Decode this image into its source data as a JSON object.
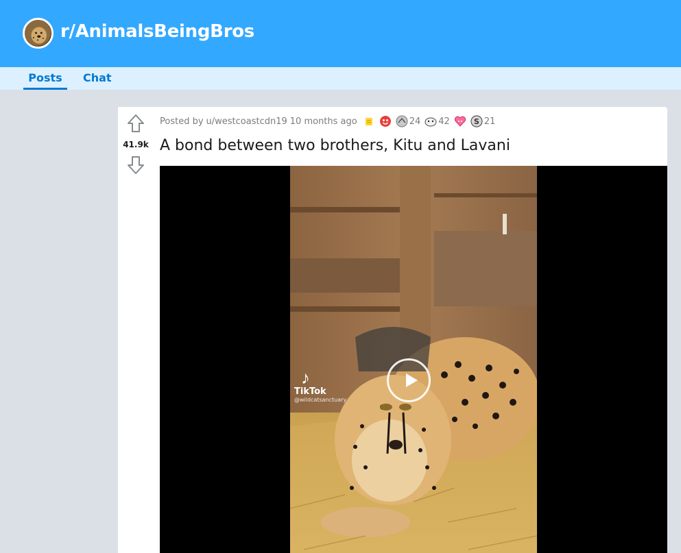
{
  "subreddit": {
    "name": "r/AnimalsBeingBros"
  },
  "tabs": [
    {
      "label": "Posts",
      "active": true
    },
    {
      "label": "Chat",
      "active": false
    }
  ],
  "post": {
    "score": "41.9k",
    "meta_prefix": "Posted by",
    "author": "u/westcoastcdn19",
    "time": "10 months ago",
    "awards": [
      {
        "icon": "helpful-award-icon",
        "count": ""
      },
      {
        "icon": "wholesome-award-icon",
        "count": ""
      },
      {
        "icon": "silver-award-icon",
        "count": "24"
      },
      {
        "icon": "take-my-energy-award-icon",
        "count": "42"
      },
      {
        "icon": "heartwarming-award-icon",
        "count": ""
      },
      {
        "icon": "silver-coin-icon",
        "count": "21"
      }
    ],
    "title": "A bond between two brothers, Kitu and Lavani",
    "video": {
      "watermark_brand": "TikTok",
      "watermark_handle": "@wildcatsanctuary"
    }
  },
  "colors": {
    "banner": "#33a8ff",
    "tab_bar": "#dcf0ff",
    "accent": "#0079d3",
    "page_bg": "#dae0e6"
  }
}
